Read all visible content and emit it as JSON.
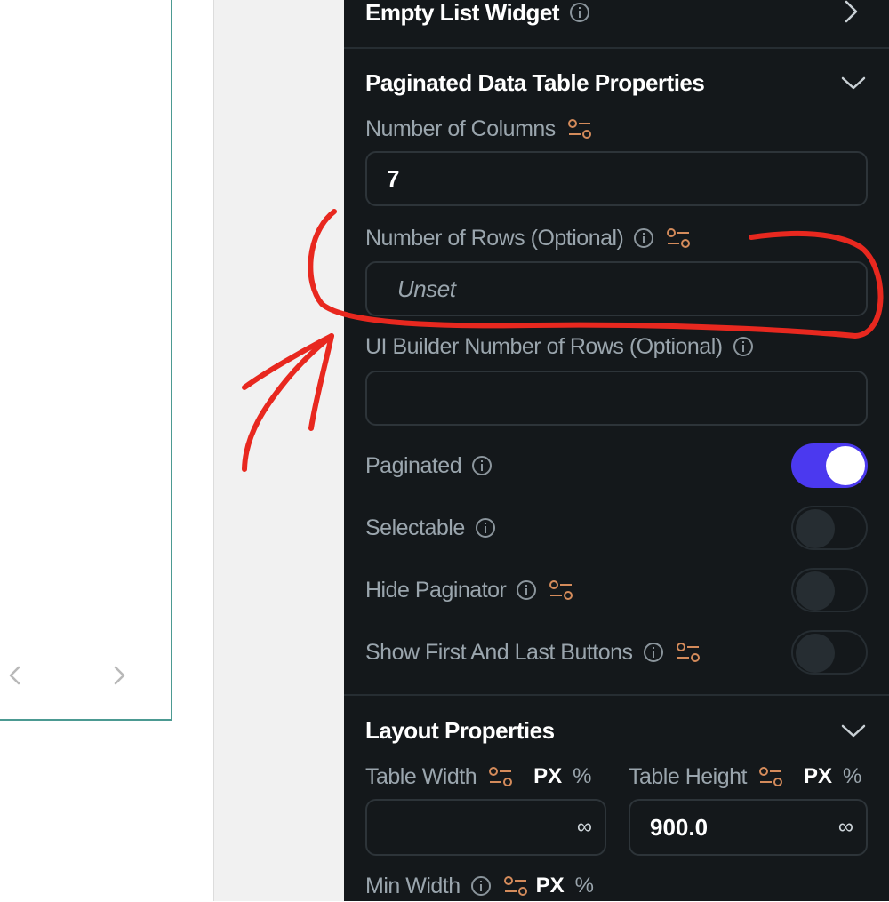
{
  "panel": {
    "empty_list_widget": "Empty List Widget",
    "section_title": "Paginated Data Table Properties",
    "num_columns_label": "Number of Columns",
    "num_columns_value": "7",
    "num_rows_label": "Number of Rows (Optional)",
    "num_rows_placeholder": "Unset",
    "ui_builder_rows_label": "UI Builder Number of Rows (Optional)",
    "ui_builder_rows_value": "",
    "toggles": [
      {
        "label": "Paginated",
        "on": true
      },
      {
        "label": "Selectable",
        "on": false
      },
      {
        "label": "Hide Paginator",
        "on": false
      },
      {
        "label": "Show First And Last Buttons",
        "on": false
      }
    ],
    "layout_title": "Layout Properties",
    "table_width_label": "Table Width",
    "table_height_label": "Table Height",
    "table_width_value": "",
    "table_height_value": "900.0",
    "unit_px": "PX",
    "unit_pct": "%",
    "infinity": "∞",
    "min_width_label": "Min Width"
  },
  "colors": {
    "panel_bg": "#14181b",
    "accent": "#4b39ef",
    "variable_icon": "#d48b5b",
    "annotation": "#e8281f",
    "table_border": "#4c9a92"
  },
  "icons": [
    "info-icon",
    "variable-icon",
    "chevron-right-icon",
    "chevron-down-icon",
    "chevron-left-icon"
  ]
}
